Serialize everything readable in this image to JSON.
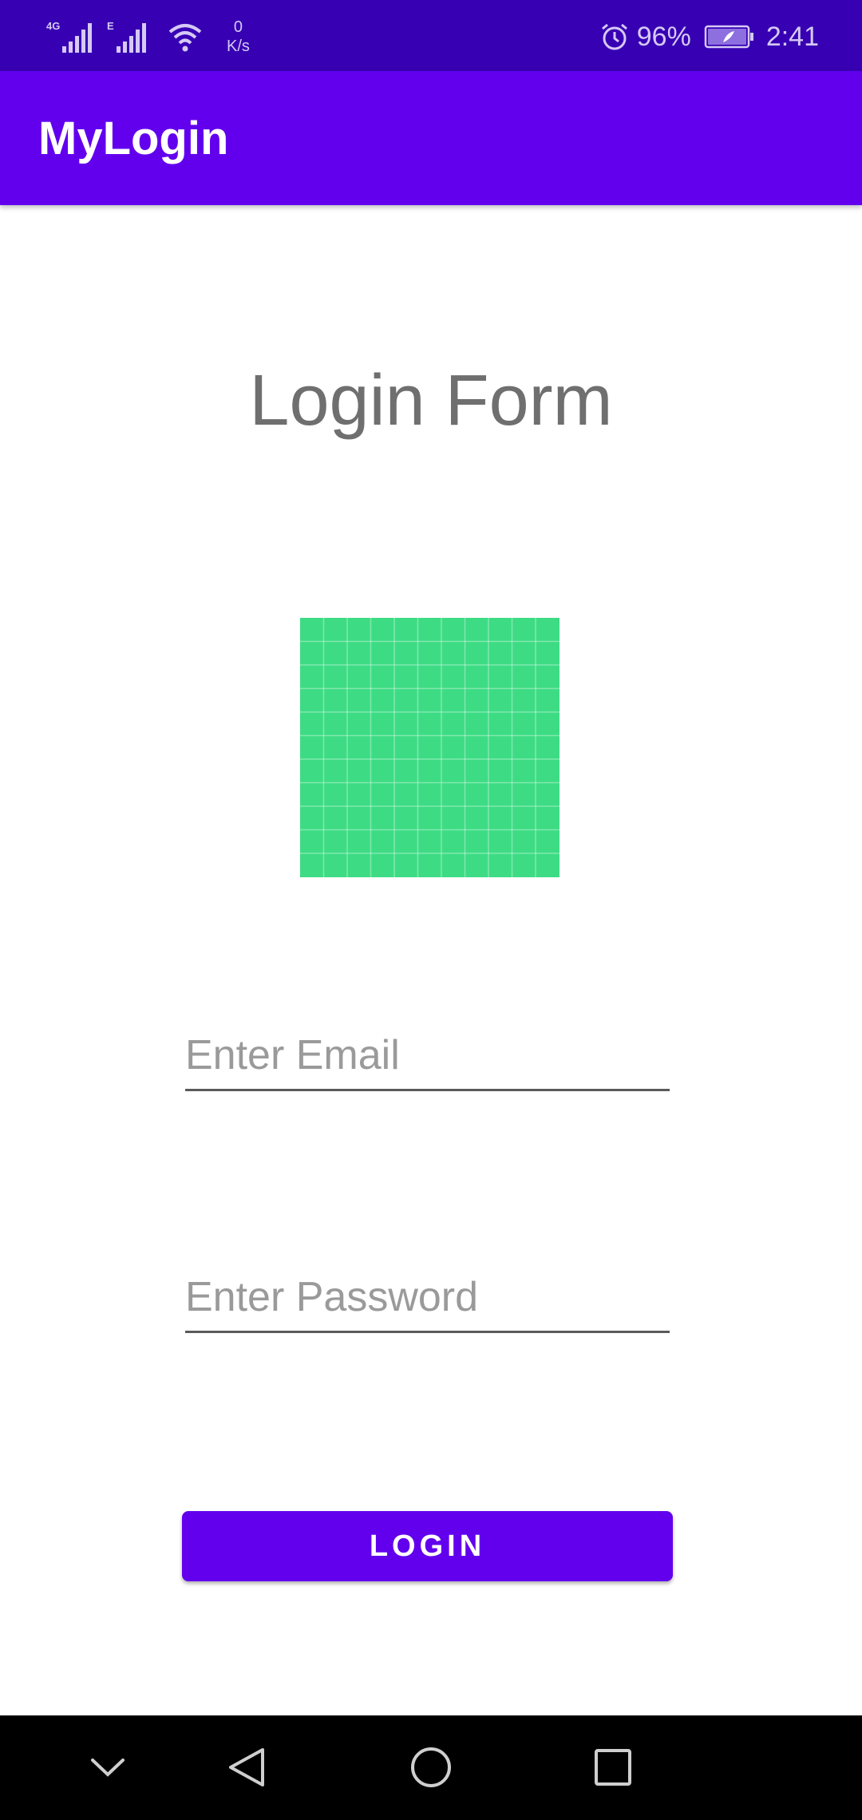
{
  "status_bar": {
    "network_1": "4G",
    "network_2": "E",
    "speed_value": "0",
    "speed_unit": "K/s",
    "battery_percent": "96%",
    "time": "2:41"
  },
  "app_bar": {
    "title": "MyLogin"
  },
  "form": {
    "heading": "Login Form",
    "email_placeholder": "Enter Email",
    "email_value": "",
    "password_placeholder": "Enter Password",
    "password_value": "",
    "login_label": "LOGIN"
  },
  "colors": {
    "status_bar": "#3700b3",
    "primary": "#6200ee",
    "image_green": "#3ddc84"
  },
  "nav_bar": {
    "buttons": [
      "chevron-down-icon",
      "back-icon",
      "home-icon",
      "recents-icon"
    ]
  }
}
